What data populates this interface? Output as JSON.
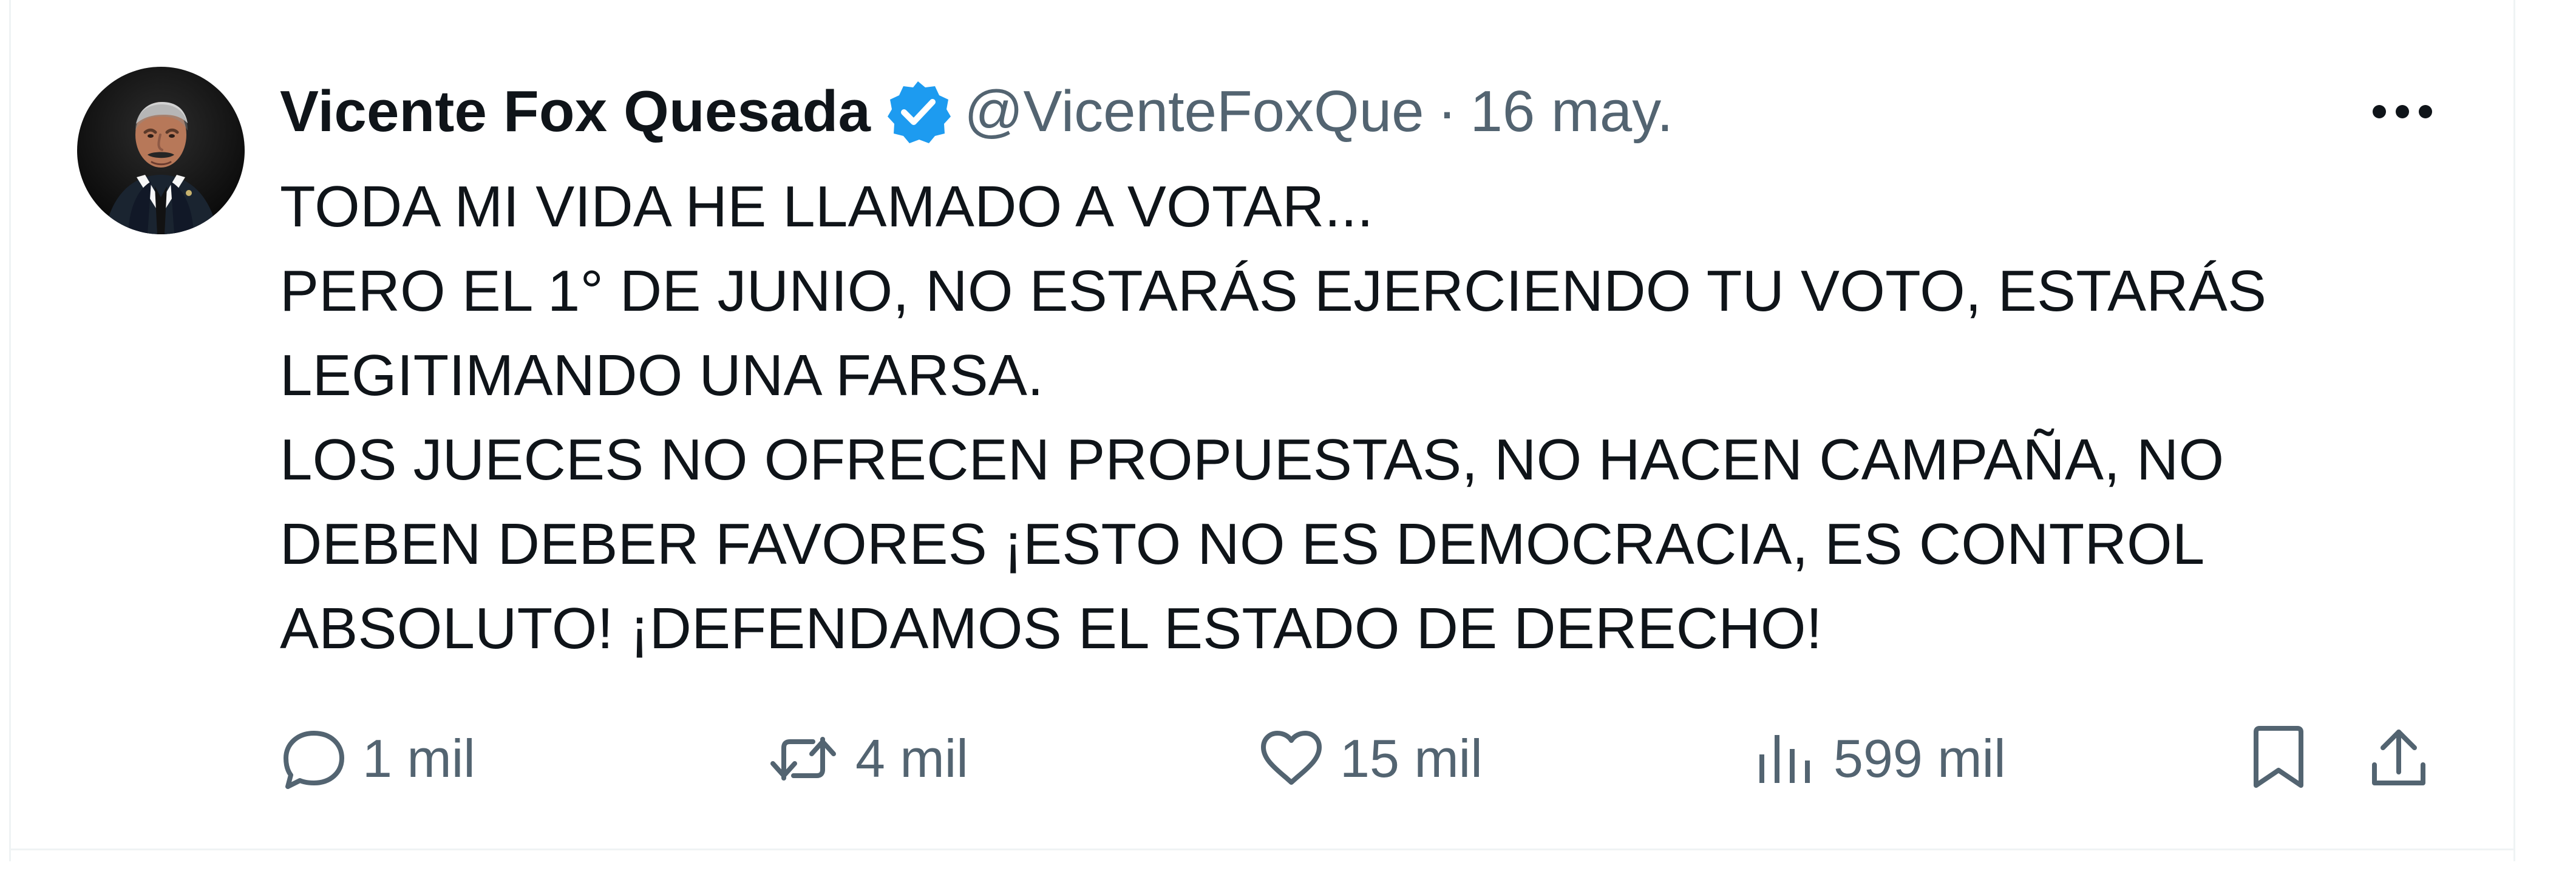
{
  "tweet": {
    "author_name": "Vicente Fox Quesada",
    "author_handle": "@VicenteFoxQue",
    "separator": "·",
    "timestamp": "16 may.",
    "text_lines": [
      "TODA MI VIDA HE LLAMADO A VOTAR...",
      "PERO EL 1° DE JUNIO, NO ESTARÁS EJERCIENDO TU VOTO, ESTARÁS",
      "LEGITIMANDO UNA FARSA.",
      "LOS JUECES NO OFRECEN PROPUESTAS, NO HACEN CAMPAÑA, NO",
      "DEBEN DEBER FAVORES ¡ESTO NO ES DEMOCRACIA, ES CONTROL",
      "ABSOLUTO! ¡DEFENDAMOS EL ESTADO DE DERECHO!"
    ]
  },
  "actions": {
    "replies": "1 mil",
    "reposts": "4 mil",
    "likes": "15 mil",
    "views": "599 mil"
  },
  "icons": {
    "verified": "verified-badge-icon",
    "more": "more-options-icon",
    "reply": "reply-icon",
    "repost": "repost-icon",
    "like": "heart-icon",
    "views": "views-icon",
    "bookmark": "bookmark-icon",
    "share": "share-icon"
  },
  "colors": {
    "text_primary": "#0f1419",
    "text_secondary": "#536471",
    "verified": "#1d9bf0",
    "border": "#eff3f4"
  }
}
